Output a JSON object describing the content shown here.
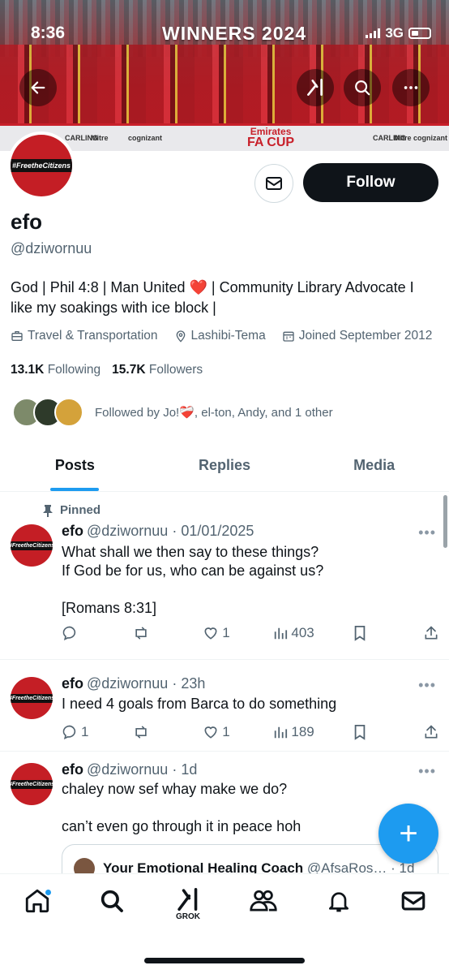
{
  "status_bar": {
    "time": "8:36",
    "network": "3G"
  },
  "banner": {
    "headline": "WINNERS 2024",
    "trophy_text_1": "Emirates",
    "trophy_text_2": "FA CUP",
    "sponsors": [
      "CARLING",
      "Mitre",
      "cognizant",
      "Mitre",
      "CARLING",
      "cognizant"
    ]
  },
  "header_icons": {
    "back": "arrow-left-icon",
    "grok": "grok-icon",
    "search": "search-icon",
    "more": "more-icon"
  },
  "profile": {
    "avatar_text": "#FreetheCitizens",
    "name": "efo",
    "handle": "@dziwornuu",
    "follow_label": "Follow",
    "bio_part1": "God | Phil 4:8 | Man United ",
    "bio_heart": "❤️",
    "bio_part2": " | Community Library Advocate I like my soakings with ice block |",
    "category": "Travel & Transportation",
    "location": "Lashibi-Tema",
    "joined": "Joined September 2012",
    "following_count": "13.1K",
    "following_label": "Following",
    "followers_count": "15.7K",
    "followers_label": "Followers",
    "followed_by": "Followed by Jo!❤️‍🩹, el-ton, Andy, and 1 other"
  },
  "tabs": [
    {
      "label": "Posts",
      "active": true
    },
    {
      "label": "Replies",
      "active": false
    },
    {
      "label": "Media",
      "active": false
    }
  ],
  "posts": [
    {
      "pinned_label": "Pinned",
      "name": "efo",
      "meta": "@dziwornuu · 01/01/2025",
      "line1": "What shall we then say to these things?",
      "line2": "If God be for us, who can be against us?",
      "line3": "[Romans 8:31]",
      "replies": "",
      "reposts": "",
      "likes": "1",
      "views": "403"
    },
    {
      "name": "efo",
      "meta": "@dziwornuu · 23h",
      "line1": "I need 4 goals from Barca to do something",
      "replies": "1",
      "reposts": "",
      "likes": "1",
      "views": "189"
    },
    {
      "name": "efo",
      "meta": "@dziwornuu · 1d",
      "line1": "chaley now sef whay make we do?",
      "line2": "can’t even go through it in peace hoh",
      "quote_name": "Your Emotional Healing Coach",
      "quote_meta": "@AfsaRos… · 1d"
    }
  ],
  "more_glyph": "•••",
  "fab_label": "+",
  "bottom_nav": {
    "grok_label": "GROK",
    "items": [
      "home-icon",
      "search-icon",
      "grok-icon",
      "communities-icon",
      "notifications-icon",
      "messages-icon"
    ]
  },
  "colors": {
    "accent": "#1d9bf0",
    "text": "#0f1419",
    "muted": "#536471",
    "avatar_red": "#c41e25"
  }
}
